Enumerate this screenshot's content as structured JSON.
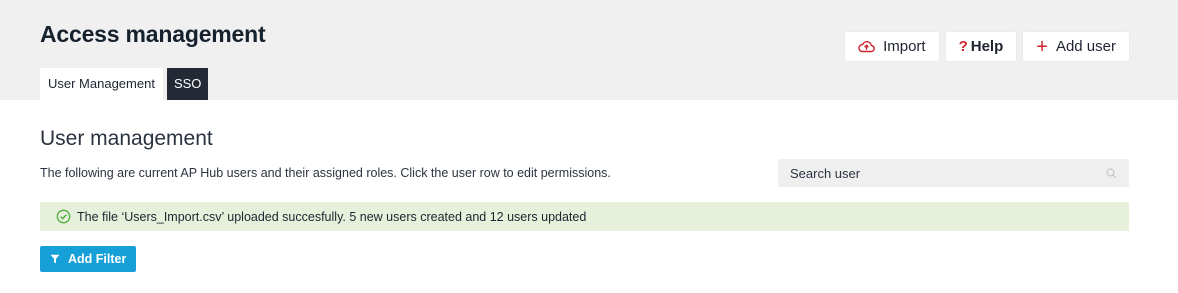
{
  "header": {
    "title": "Access management",
    "tabs": [
      {
        "label": "User Management",
        "active": true
      },
      {
        "label": "SSO",
        "active": false
      }
    ],
    "actions": {
      "import_label": "Import",
      "import_icon": "cloud-upload-icon",
      "help_mark": "?",
      "help_label": "Help",
      "add_user_mark": "+",
      "add_user_label": "Add user"
    }
  },
  "main": {
    "title": "User management",
    "description": "The following are current AP Hub users and their assigned roles. Click the user row to edit permissions.",
    "search": {
      "placeholder": "Search user",
      "icon": "search-icon"
    },
    "alert": {
      "icon": "check-circle-icon",
      "message": "The file ‘Users_Import.csv’ uploaded succesfully. 5 new users created and 12 users updated"
    },
    "filter_button": {
      "label": "Add Filter",
      "icon": "filter-icon"
    }
  },
  "colors": {
    "accent_red": "#d0242b",
    "filter_blue": "#17a0d8",
    "success_bg": "#e6f0da",
    "success_icon": "#4fae3f",
    "header_bg": "#f0f0f0",
    "dark_tab": "#232a35"
  }
}
